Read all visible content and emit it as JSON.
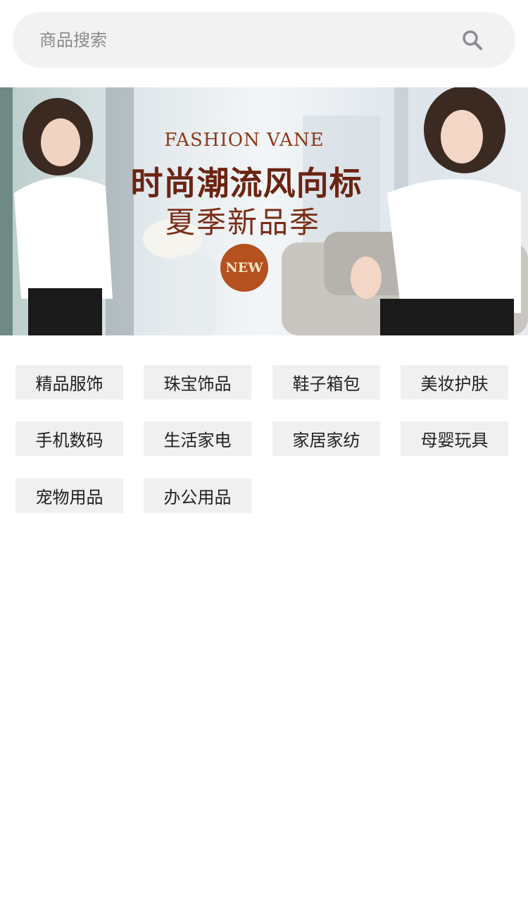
{
  "search": {
    "placeholder": "商品搜索",
    "icon": "search-icon"
  },
  "banner": {
    "eyebrow": "FASHION VANE",
    "title": "时尚潮流风向标",
    "subtitle": "夏季新品季",
    "badge": "NEW"
  },
  "categories": [
    {
      "label": "精品服饰"
    },
    {
      "label": "珠宝饰品"
    },
    {
      "label": "鞋子箱包"
    },
    {
      "label": "美妆护肤"
    },
    {
      "label": "手机数码"
    },
    {
      "label": "生活家电"
    },
    {
      "label": "家居家纺"
    },
    {
      "label": "母婴玩具"
    },
    {
      "label": "宠物用品"
    },
    {
      "label": "办公用品"
    }
  ]
}
